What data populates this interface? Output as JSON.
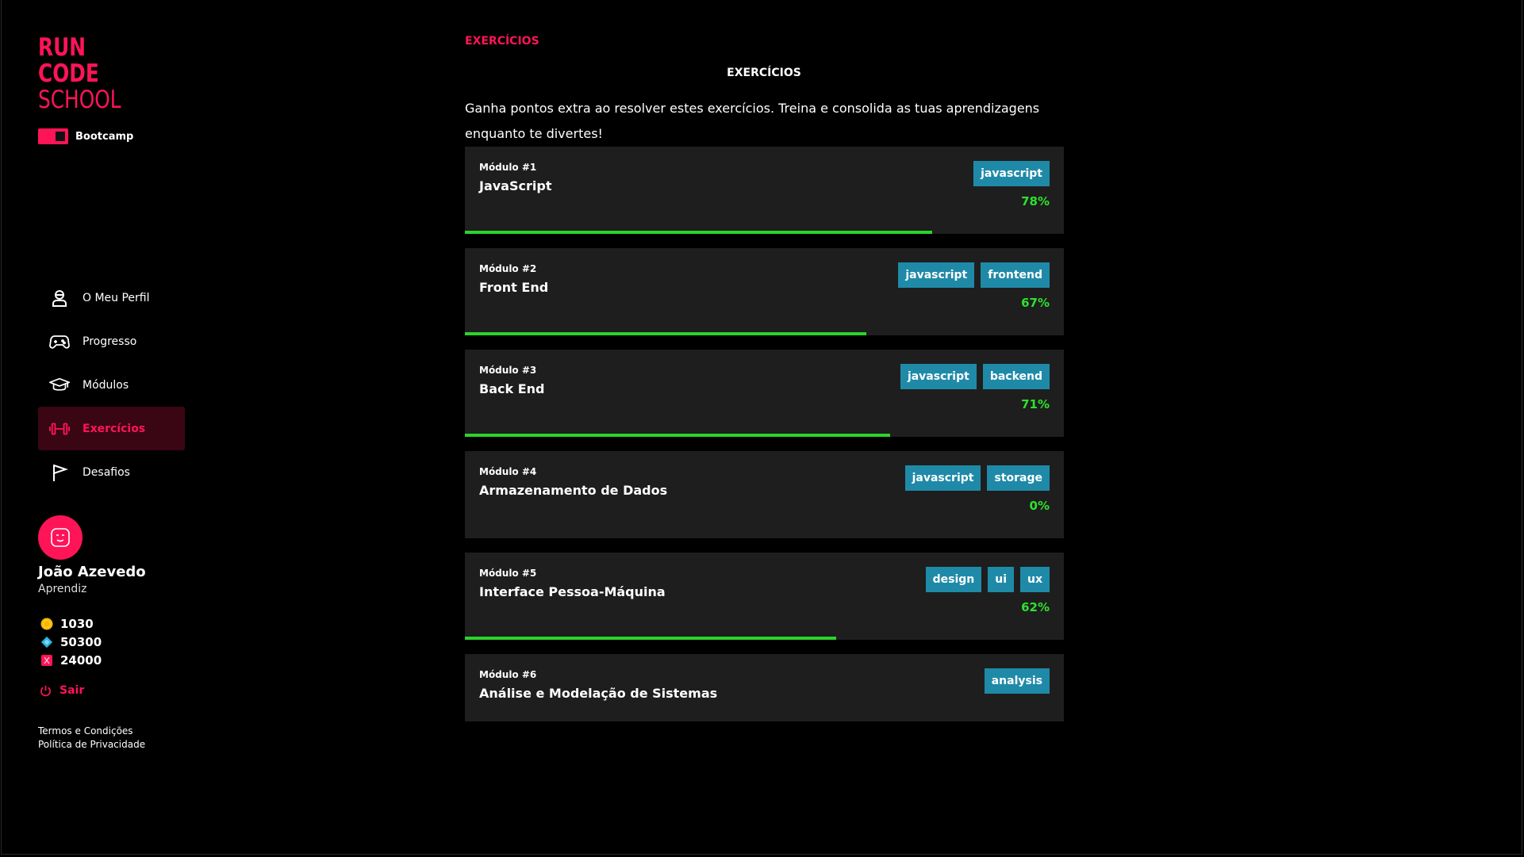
{
  "brand": {
    "line1": "RUN",
    "line2": "CODE",
    "line3": "SCHOOL",
    "accent": "#ff1458"
  },
  "program": {
    "label": "Bootcamp"
  },
  "nav": [
    {
      "label": "O Meu Perfil",
      "icon": "user-icon",
      "active": false
    },
    {
      "label": "Progresso",
      "icon": "gamepad-icon",
      "active": false
    },
    {
      "label": "Módulos",
      "icon": "graduation-cap-icon",
      "active": false
    },
    {
      "label": "Exercícios",
      "icon": "dumbbell-icon",
      "active": true
    },
    {
      "label": "Desafios",
      "icon": "flag-icon",
      "active": false
    }
  ],
  "user": {
    "name": "João Azevedo",
    "role": "Aprendiz",
    "stats": [
      {
        "icon": "coin-icon",
        "value": "1030"
      },
      {
        "icon": "diamond-icon",
        "value": "50300"
      },
      {
        "icon": "xp-icon",
        "value": "24000"
      }
    ]
  },
  "logout_label": "Sair",
  "legal": {
    "terms": "Termos e Condições",
    "privacy": "Política de Privacidade"
  },
  "main": {
    "breadcrumb": "EXERCÍCIOS",
    "title": "EXERCÍCIOS",
    "intro": "Ganha pontos extra ao resolver estes exercícios. Treina e consolida as tuas aprendizagens enquanto te divertes!"
  },
  "modules": [
    {
      "number": "Módulo #1",
      "name": "JavaScript",
      "tags": [
        "javascript"
      ],
      "percent": "78%",
      "progress": 0.78
    },
    {
      "number": "Módulo #2",
      "name": "Front End",
      "tags": [
        "javascript",
        "frontend"
      ],
      "percent": "67%",
      "progress": 0.67
    },
    {
      "number": "Módulo #3",
      "name": "Back End",
      "tags": [
        "javascript",
        "backend"
      ],
      "percent": "71%",
      "progress": 0.71
    },
    {
      "number": "Módulo #4",
      "name": "Armazenamento de Dados",
      "tags": [
        "javascript",
        "storage"
      ],
      "percent": "0%",
      "progress": 0
    },
    {
      "number": "Módulo #5",
      "name": "Interface Pessoa-Máquina",
      "tags": [
        "design",
        "ui",
        "ux"
      ],
      "percent": "62%",
      "progress": 0.62
    },
    {
      "number": "Módulo #6",
      "name": "Análise e Modelação de Sistemas",
      "tags": [
        "analysis"
      ],
      "percent": null,
      "progress": null
    }
  ],
  "colors": {
    "tag": "#1f8aa8",
    "progress": "#2bd42b",
    "percent": "#2de22d",
    "card": "#1e1e1e"
  }
}
